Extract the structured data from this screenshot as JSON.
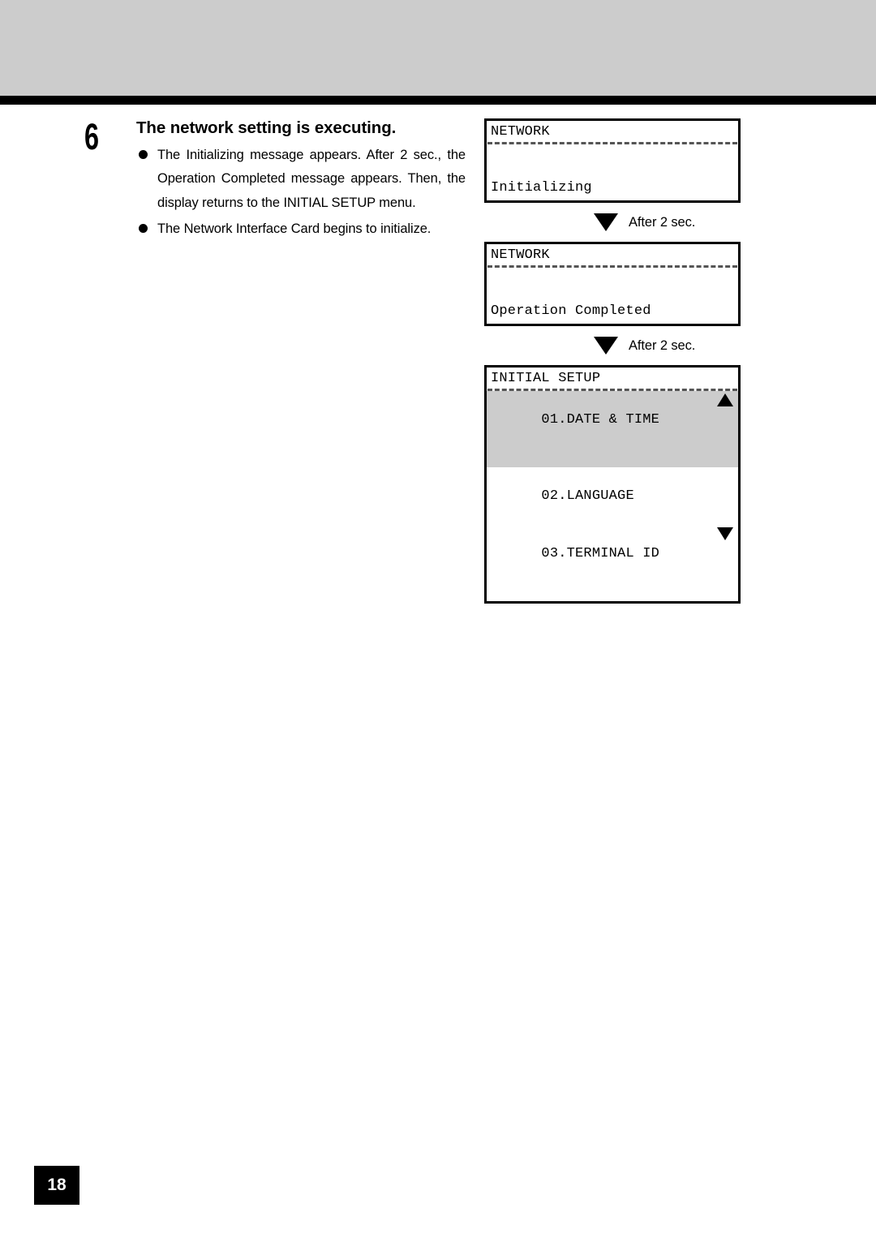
{
  "page": {
    "number": "18"
  },
  "step": {
    "number": "6",
    "title": "The network setting is executing.",
    "bullets": [
      "The Initializing message appears.  After 2 sec., the Operation Completed message appears. Then, the display returns to the INITIAL SETUP menu.",
      "The Network Interface Card begins to initialize."
    ]
  },
  "displays": {
    "panel1": {
      "title": "NETWORK",
      "message": "Initializing"
    },
    "panel2": {
      "title": "NETWORK",
      "message": "Operation Completed"
    },
    "panel3": {
      "title": "INITIAL SETUP",
      "rows": [
        {
          "label": "01.DATE & TIME",
          "selected": true,
          "arrow": "up-arrow-icon"
        },
        {
          "label": "02.LANGUAGE",
          "selected": false,
          "arrow": ""
        },
        {
          "label": "03.TERMINAL ID",
          "selected": false,
          "arrow": "down-arrow-icon"
        }
      ]
    }
  },
  "transitions": [
    {
      "label": "After 2 sec.",
      "icon": "triangle-down-icon"
    },
    {
      "label": "After 2 sec.",
      "icon": "triangle-down-icon"
    }
  ],
  "colors": {
    "header_band": "#cccccc",
    "rule": "#000000",
    "highlight": "#cccccc",
    "text": "#000000"
  }
}
